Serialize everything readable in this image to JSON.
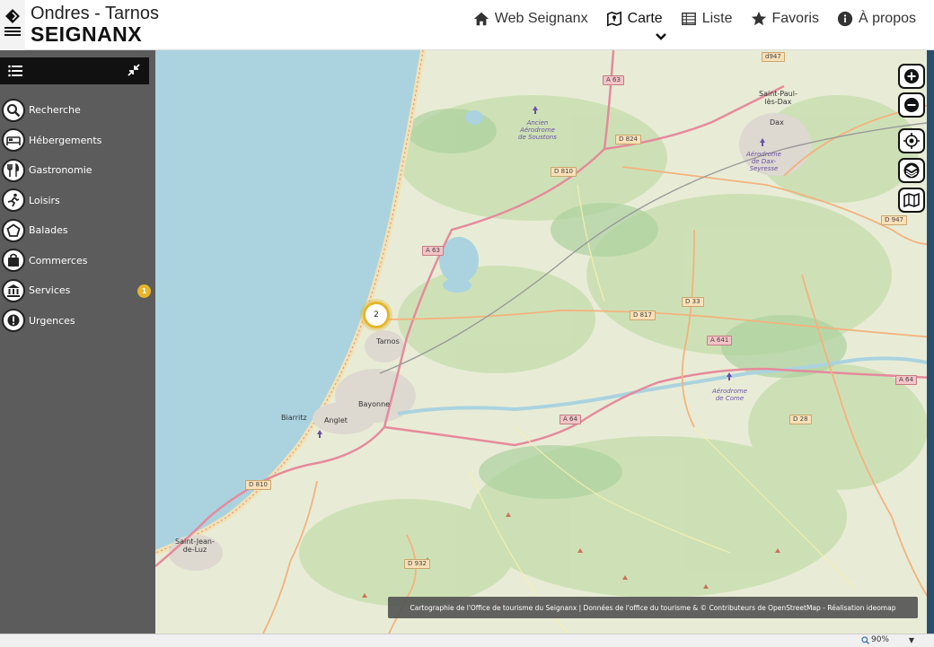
{
  "brand": {
    "top": "Ondres - Tarnos",
    "bottom": "SEIGNANX"
  },
  "nav": [
    {
      "label": "Web Seignanx",
      "icon": "home-icon"
    },
    {
      "label": "Carte",
      "icon": "map-icon",
      "active": true
    },
    {
      "label": "Liste",
      "icon": "list-icon"
    },
    {
      "label": "Favoris",
      "icon": "star-icon"
    },
    {
      "label": "À propos",
      "icon": "info-icon"
    }
  ],
  "sidebar": {
    "items": [
      {
        "label": "Recherche",
        "icon": "search-icon"
      },
      {
        "label": "Hébergements",
        "icon": "bed-icon"
      },
      {
        "label": "Gastronomie",
        "icon": "cutlery-icon"
      },
      {
        "label": "Loisirs",
        "icon": "running-icon"
      },
      {
        "label": "Balades",
        "icon": "pentagon-icon"
      },
      {
        "label": "Commerces",
        "icon": "shop-icon"
      },
      {
        "label": "Services",
        "icon": "bank-icon",
        "badge": "1"
      },
      {
        "label": "Urgences",
        "icon": "warning-icon"
      }
    ]
  },
  "map": {
    "cluster_count": "2",
    "places": {
      "saint_paul": "Saint-Paul-\nlès-Dax",
      "dax": "Dax",
      "tarnos": "Tarnos",
      "bayonne": "Bayonne",
      "biarritz": "Biarritz",
      "anglet": "Anglet",
      "saint_jean": "Saint-Jean-\nde-Luz"
    },
    "airports": {
      "soustons": "Ancien\nAérodrome\nde Soustons",
      "dax": "Aérodrome\nde Dax-\nSeyresse",
      "come": "Aérodrome\nde Come"
    },
    "roads": {
      "d947_top": "d947",
      "a63_top": "A 63",
      "d824": "D 824",
      "d810_top": "D 810",
      "d947_right": "D 947",
      "a63_mid": "A 63",
      "d33": "D 33",
      "d817": "D 817",
      "a641": "A 641",
      "a64_right": "A 64",
      "a64_mid": "A 64",
      "d28": "D 28",
      "d810_bottom": "D 810",
      "d932": "D 932"
    },
    "attribution": "Cartographie de l'Office de tourisme du Seignanx | Données de l'office du tourisme & © Contributeurs de OpenStreetMap - Réalisation ideomap"
  },
  "status": {
    "zoom": "90%"
  }
}
